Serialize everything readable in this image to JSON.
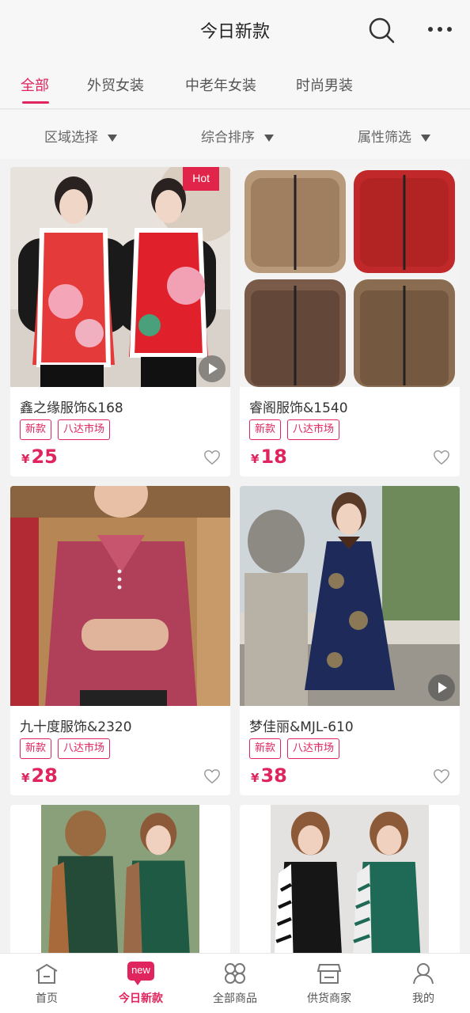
{
  "header": {
    "title": "今日新款",
    "search_icon": "search-icon",
    "more_icon": "more-icon"
  },
  "tabs": [
    {
      "label": "全部",
      "active": true
    },
    {
      "label": "外贸女装",
      "active": false
    },
    {
      "label": "中老年女装",
      "active": false
    },
    {
      "label": "时尚男装",
      "active": false
    }
  ],
  "filters": [
    {
      "label": "区域选择"
    },
    {
      "label": "综合排序"
    },
    {
      "label": "属性筛选"
    }
  ],
  "products": [
    {
      "name": "鑫之缘服饰&168",
      "tags": [
        "新款",
        "八达市场"
      ],
      "currency": "¥",
      "price": "25",
      "hot": "Hot",
      "video": true
    },
    {
      "name": "睿阁服饰&1540",
      "tags": [
        "新款",
        "八达市场"
      ],
      "currency": "¥",
      "price": "18",
      "hot": "",
      "video": false
    },
    {
      "name": "九十度服饰&2320",
      "tags": [
        "新款",
        "八达市场"
      ],
      "currency": "¥",
      "price": "28",
      "hot": "",
      "video": false
    },
    {
      "name": "梦佳丽&MJL-610",
      "tags": [
        "新款",
        "八达市场"
      ],
      "currency": "¥",
      "price": "38",
      "hot": "",
      "video": true
    },
    {
      "name": "",
      "tags": [],
      "currency": "",
      "price": "",
      "hot": "",
      "video": false
    },
    {
      "name": "",
      "tags": [],
      "currency": "",
      "price": "",
      "hot": "",
      "video": false
    }
  ],
  "bottom_nav": [
    {
      "label": "首页",
      "icon": "home-icon",
      "active": false
    },
    {
      "label": "今日新款",
      "icon": "new-badge-icon",
      "badge": "new",
      "active": true
    },
    {
      "label": "全部商品",
      "icon": "grid-icon",
      "active": false
    },
    {
      "label": "供货商家",
      "icon": "store-icon",
      "active": false
    },
    {
      "label": "我的",
      "icon": "profile-icon",
      "active": false
    }
  ],
  "colors": {
    "accent": "#e0245e"
  }
}
